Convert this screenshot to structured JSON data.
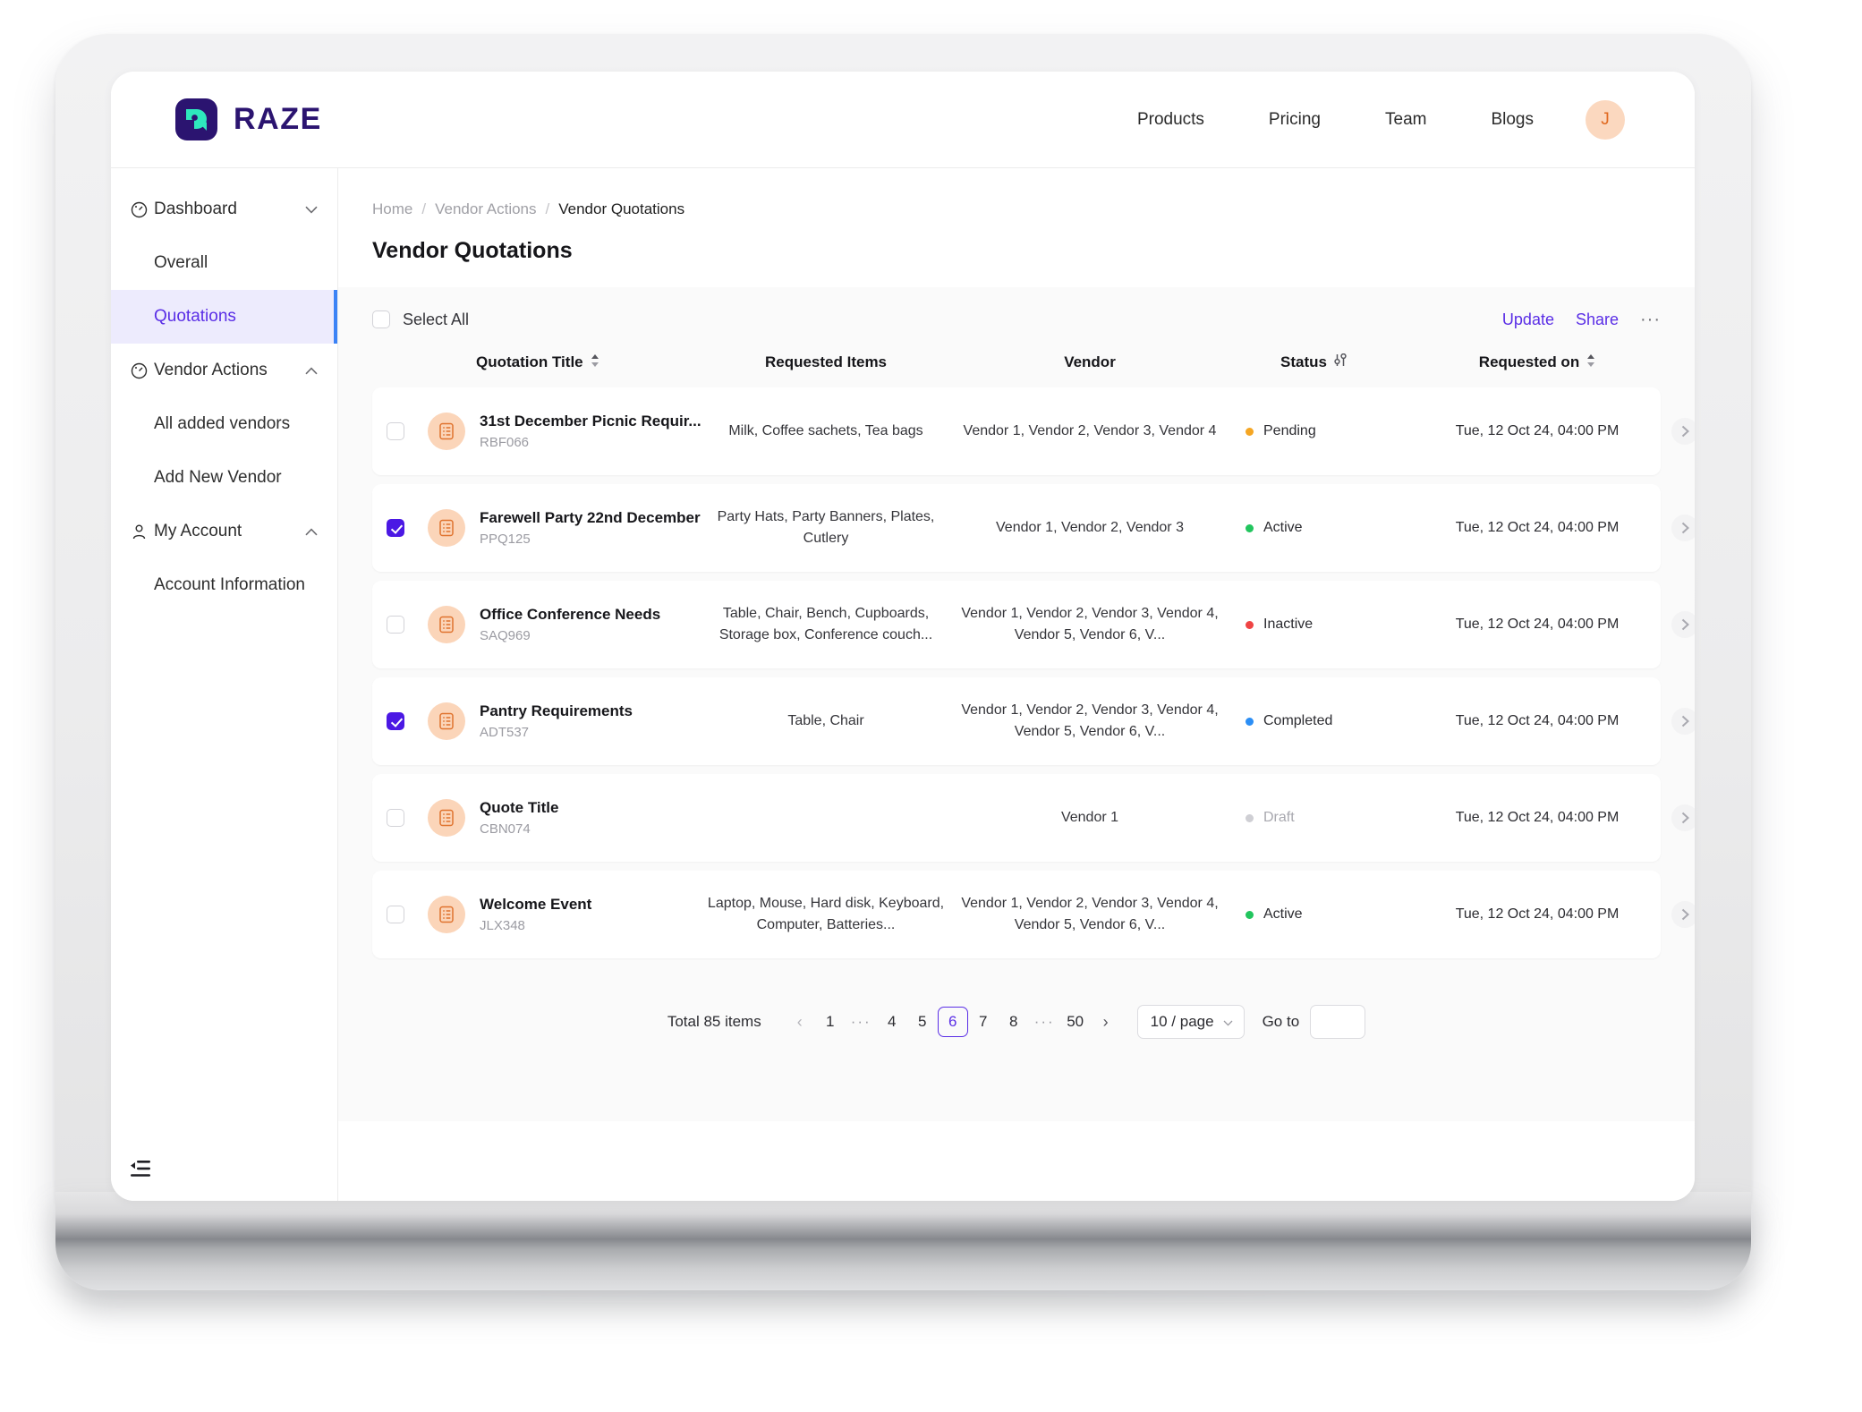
{
  "brand": {
    "name": "RAZE",
    "mark_icon": "raze-logo-icon",
    "mark_color": "#2b1470",
    "accent_color": "#2ee8bd"
  },
  "topnav": {
    "links": [
      {
        "label": "Products"
      },
      {
        "label": "Pricing"
      },
      {
        "label": "Team"
      },
      {
        "label": "Blogs"
      }
    ],
    "avatar_initial": "J"
  },
  "sidebar": {
    "items": [
      {
        "label": "Dashboard",
        "icon": "gauge-icon",
        "chevron": "chevron-down-icon",
        "child": false,
        "active": false
      },
      {
        "label": "Overall",
        "icon": "",
        "chevron": "",
        "child": true,
        "active": false
      },
      {
        "label": "Quotations",
        "icon": "",
        "chevron": "",
        "child": true,
        "active": true
      },
      {
        "label": "Vendor Actions",
        "icon": "gauge-icon",
        "chevron": "chevron-up-icon",
        "child": false,
        "active": false
      },
      {
        "label": "All added vendors",
        "icon": "",
        "chevron": "",
        "child": true,
        "active": false
      },
      {
        "label": "Add New Vendor",
        "icon": "",
        "chevron": "",
        "child": true,
        "active": false
      },
      {
        "label": "My Account",
        "icon": "person-icon",
        "chevron": "chevron-up-icon",
        "child": false,
        "active": false
      },
      {
        "label": "Account Information",
        "icon": "",
        "chevron": "",
        "child": true,
        "active": false
      }
    ],
    "collapse_icon": "collapse-sidebar-icon"
  },
  "breadcrumb": [
    {
      "label": "Home",
      "current": false
    },
    {
      "label": "Vendor Actions",
      "current": false
    },
    {
      "label": "Vendor Quotations",
      "current": true
    }
  ],
  "page_title": "Vendor Quotations",
  "toolbar": {
    "select_all_label": "Select All",
    "select_all_checked": false,
    "update_label": "Update",
    "share_label": "Share",
    "more_label": "···",
    "link_color": "#5a2ee6"
  },
  "table": {
    "columns": [
      {
        "key": "title",
        "label": "Quotation Title",
        "sortable": true,
        "filter": false
      },
      {
        "key": "items",
        "label": "Requested Items",
        "sortable": false,
        "filter": false
      },
      {
        "key": "vendor",
        "label": "Vendor",
        "sortable": false,
        "filter": false
      },
      {
        "key": "status",
        "label": "Status",
        "sortable": false,
        "filter": true
      },
      {
        "key": "date",
        "label": "Requested on",
        "sortable": true,
        "filter": false
      }
    ],
    "rows": [
      {
        "checked": false,
        "title": "31st December Picnic Requir...",
        "code": "RBF066",
        "items": "Milk, Coffee sachets, Tea bags",
        "vendor": "Vendor 1, Vendor 2, Vendor 3, Vendor 4",
        "status": "Pending",
        "status_color": "#f5a623",
        "status_text_color": "#2c2c31",
        "date": "Tue, 12 Oct 24, 04:00 PM"
      },
      {
        "checked": true,
        "title": "Farewell Party 22nd December",
        "code": "PPQ125",
        "items": "Party Hats, Party Banners, Plates, Cutlery",
        "vendor": "Vendor 1, Vendor 2, Vendor 3",
        "status": "Active",
        "status_color": "#22c55e",
        "status_text_color": "#2c2c31",
        "date": "Tue, 12 Oct 24, 04:00 PM"
      },
      {
        "checked": false,
        "title": "Office Conference Needs",
        "code": "SAQ969",
        "items": "Table, Chair, Bench, Cupboards, Storage box, Conference couch...",
        "vendor": "Vendor 1, Vendor 2, Vendor 3, Vendor 4, Vendor 5, Vendor 6, V...",
        "status": "Inactive",
        "status_color": "#ef4444",
        "status_text_color": "#2c2c31",
        "date": "Tue, 12 Oct 24, 04:00 PM"
      },
      {
        "checked": true,
        "title": "Pantry Requirements",
        "code": "ADT537",
        "items": "Table, Chair",
        "vendor": "Vendor 1, Vendor 2, Vendor 3, Vendor 4, Vendor 5, Vendor 6, V...",
        "status": "Completed",
        "status_color": "#2b8ef5",
        "status_text_color": "#2c2c31",
        "date": "Tue, 12 Oct 24, 04:00 PM"
      },
      {
        "checked": false,
        "title": "Quote Title",
        "code": "CBN074",
        "items": "",
        "vendor": "Vendor 1",
        "status": "Draft",
        "status_color": "#cfcfd4",
        "status_text_color": "#a8a8af",
        "date": "Tue, 12 Oct 24, 04:00 PM"
      },
      {
        "checked": false,
        "title": "Welcome Event",
        "code": "JLX348",
        "items": "Laptop, Mouse, Hard disk, Keyboard, Computer, Batteries...",
        "vendor": "Vendor 1, Vendor 2, Vendor 3, Vendor 4, Vendor 5, Vendor 6, V...",
        "status": "Active",
        "status_color": "#22c55e",
        "status_text_color": "#2c2c31",
        "date": "Tue, 12 Oct 24, 04:00 PM"
      }
    ]
  },
  "pagination": {
    "total_label": "Total 85 items",
    "prev_label": "‹",
    "next_label": "›",
    "prev_enabled": false,
    "next_enabled": true,
    "pages": [
      {
        "label": "1",
        "type": "page",
        "current": false
      },
      {
        "label": "···",
        "type": "ellipsis",
        "current": false
      },
      {
        "label": "4",
        "type": "page",
        "current": false
      },
      {
        "label": "5",
        "type": "page",
        "current": false
      },
      {
        "label": "6",
        "type": "page",
        "current": true
      },
      {
        "label": "7",
        "type": "page",
        "current": false
      },
      {
        "label": "8",
        "type": "page",
        "current": false
      },
      {
        "label": "···",
        "type": "ellipsis",
        "current": false
      },
      {
        "label": "50",
        "type": "page",
        "current": false
      }
    ],
    "page_size_label": "10 / page",
    "goto_label": "Go to",
    "goto_value": ""
  }
}
